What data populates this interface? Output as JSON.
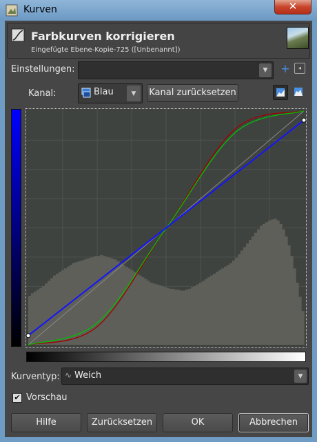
{
  "window": {
    "title": "Kurven",
    "close_label": "✕"
  },
  "header": {
    "title": "Farbkurven korrigieren",
    "subtitle": "Eingefügte Ebene-Kopie-725 ([Unbenannt])"
  },
  "settings": {
    "label": "Einstellungen:",
    "value": ""
  },
  "channel": {
    "label": "Kanal:",
    "value": "Blau",
    "reset_label": "Kanal zurücksetzen"
  },
  "curve_type": {
    "label": "Kurventyp:",
    "value": "Weich"
  },
  "preview": {
    "label": "Vorschau",
    "checked": true
  },
  "buttons": {
    "help": "Hilfe",
    "reset": "Zurücksetzen",
    "ok": "OK",
    "cancel": "Abbrechen"
  },
  "colors": {
    "plot_bg": "#3f4340",
    "histogram": "#5e5f58",
    "red_curve": "#a00000",
    "green_curve": "#00c000",
    "blue_curve": "#1414ff",
    "identity": "#8a8a8a"
  },
  "chart_data": {
    "type": "area",
    "xlim": [
      0,
      255
    ],
    "ylim": [
      0,
      255
    ],
    "grid": true,
    "histogram": [
      55,
      58,
      60,
      62,
      64,
      66,
      69,
      72,
      75,
      78,
      80,
      82,
      84,
      86,
      88,
      90,
      92,
      93,
      94,
      95,
      96,
      97,
      98,
      99,
      100,
      100,
      101,
      100,
      99,
      98,
      97,
      96,
      94,
      92,
      90,
      88,
      86,
      84,
      82,
      80,
      78,
      76,
      74,
      72,
      70,
      69,
      68,
      67,
      66,
      65,
      64,
      63,
      63,
      62,
      62,
      61,
      61,
      62,
      63,
      65,
      66,
      68,
      70,
      72,
      74,
      76,
      78,
      80,
      82,
      84,
      86,
      88,
      90,
      92,
      95,
      98,
      102,
      106,
      110,
      114,
      118,
      122,
      126,
      130,
      134,
      136,
      138,
      140,
      141,
      142,
      140,
      136,
      130,
      122,
      112,
      100,
      86,
      70,
      54,
      38
    ],
    "curves": [
      {
        "name": "red",
        "points": [
          [
            0,
            0
          ],
          [
            64,
            20
          ],
          [
            128,
            128
          ],
          [
            192,
            236
          ],
          [
            255,
            255
          ]
        ]
      },
      {
        "name": "green",
        "points": [
          [
            0,
            0
          ],
          [
            64,
            24
          ],
          [
            128,
            128
          ],
          [
            192,
            232
          ],
          [
            255,
            255
          ]
        ]
      },
      {
        "name": "blue",
        "points": [
          [
            0,
            10
          ],
          [
            128,
            128
          ],
          [
            255,
            245
          ]
        ]
      }
    ],
    "control_points": [
      [
        0,
        10
      ],
      [
        255,
        245
      ]
    ]
  }
}
